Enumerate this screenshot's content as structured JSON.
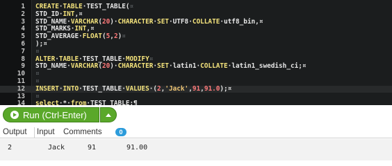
{
  "editor": {
    "lines": [
      {
        "num": "1",
        "tokens": [
          {
            "t": "CREATE",
            "c": "kw"
          },
          {
            "t": "·"
          },
          {
            "t": "TABLE",
            "c": "kw"
          },
          {
            "t": "·TEST_TABLE("
          },
          {
            "t": "¤",
            "c": "inv"
          }
        ]
      },
      {
        "num": "2",
        "tokens": [
          {
            "t": "STD_ID·"
          },
          {
            "t": "INT",
            "c": "kw"
          },
          {
            "t": ",¤"
          }
        ]
      },
      {
        "num": "3",
        "tokens": [
          {
            "t": "STD_NAME·"
          },
          {
            "t": "VARCHAR",
            "c": "kw"
          },
          {
            "t": "("
          },
          {
            "t": "20",
            "c": "num"
          },
          {
            "t": ")·"
          },
          {
            "t": "CHARACTER",
            "c": "kw"
          },
          {
            "t": "·"
          },
          {
            "t": "SET",
            "c": "kw"
          },
          {
            "t": "·UTF8·"
          },
          {
            "t": "COLLATE",
            "c": "kw"
          },
          {
            "t": "·utf8_bin,¤"
          }
        ]
      },
      {
        "num": "4",
        "tokens": [
          {
            "t": "STD_MARKS·"
          },
          {
            "t": "INT",
            "c": "kw"
          },
          {
            "t": ",¤"
          }
        ]
      },
      {
        "num": "5",
        "tokens": [
          {
            "t": "STD_AVERAGE·"
          },
          {
            "t": "FLOAT",
            "c": "kw"
          },
          {
            "t": "("
          },
          {
            "t": "5",
            "c": "num"
          },
          {
            "t": ","
          },
          {
            "t": "2",
            "c": "num"
          },
          {
            "t": ")"
          },
          {
            "t": "¤",
            "c": "inv"
          }
        ]
      },
      {
        "num": "6",
        "tokens": [
          {
            "t": ");¤"
          }
        ]
      },
      {
        "num": "7",
        "tokens": [
          {
            "t": "¤",
            "c": "inv"
          }
        ]
      },
      {
        "num": "8",
        "tokens": [
          {
            "t": "ALTER",
            "c": "kw"
          },
          {
            "t": "·"
          },
          {
            "t": "TABLE",
            "c": "kw"
          },
          {
            "t": "·TEST_TABLE·"
          },
          {
            "t": "MODIFY",
            "c": "kw"
          },
          {
            "t": "¤",
            "c": "inv"
          }
        ]
      },
      {
        "num": "9",
        "tokens": [
          {
            "t": "STD_NAME·"
          },
          {
            "t": "VARCHAR",
            "c": "kw"
          },
          {
            "t": "("
          },
          {
            "t": "20",
            "c": "num"
          },
          {
            "t": ")·"
          },
          {
            "t": "CHARACTER",
            "c": "kw"
          },
          {
            "t": "·"
          },
          {
            "t": "SET",
            "c": "kw"
          },
          {
            "t": "·latin1·"
          },
          {
            "t": "COLLATE",
            "c": "kw"
          },
          {
            "t": "·latin1_swedish_ci;¤"
          }
        ]
      },
      {
        "num": "10",
        "tokens": [
          {
            "t": "¤",
            "c": "inv"
          }
        ]
      },
      {
        "num": "11",
        "tokens": [
          {
            "t": "¤",
            "c": "inv"
          }
        ]
      },
      {
        "num": "12",
        "tokens": [
          {
            "t": "INSERT",
            "c": "kw"
          },
          {
            "t": "·"
          },
          {
            "t": "INTO",
            "c": "kw"
          },
          {
            "t": "·TEST_TABLE·"
          },
          {
            "t": "VALUES",
            "c": "kw"
          },
          {
            "t": "·("
          },
          {
            "t": "2",
            "c": "num"
          },
          {
            "t": ","
          },
          {
            "t": "'Jack'",
            "c": "str"
          },
          {
            "t": ","
          },
          {
            "t": "91",
            "c": "num"
          },
          {
            "t": ","
          },
          {
            "t": "91.0",
            "c": "num"
          },
          {
            "t": ");¤"
          }
        ]
      },
      {
        "num": "13",
        "tokens": [
          {
            "t": "¤",
            "c": "inv"
          }
        ]
      },
      {
        "num": "14",
        "tokens": [
          {
            "t": "select",
            "c": "kw"
          },
          {
            "t": "·*·"
          },
          {
            "t": "from",
            "c": "kw"
          },
          {
            "t": "·TEST_TABLE;¶"
          }
        ]
      }
    ],
    "active_line": 12
  },
  "run_button": {
    "label": "Run (Ctrl-Enter)"
  },
  "tabs": {
    "output": "Output",
    "input": "Input",
    "comments": "Comments",
    "comments_count": "0"
  },
  "output": {
    "row": [
      "2",
      "Jack",
      "91",
      "91.00"
    ]
  },
  "colors": {
    "run_green": "#5aa82a",
    "badge_blue": "#2d9cdb",
    "editor_bg": "#1b1d1e",
    "keyword": "#f4e37c"
  },
  "icons": {
    "run": "play-circle-icon",
    "dropdown": "chevron-up-icon"
  }
}
